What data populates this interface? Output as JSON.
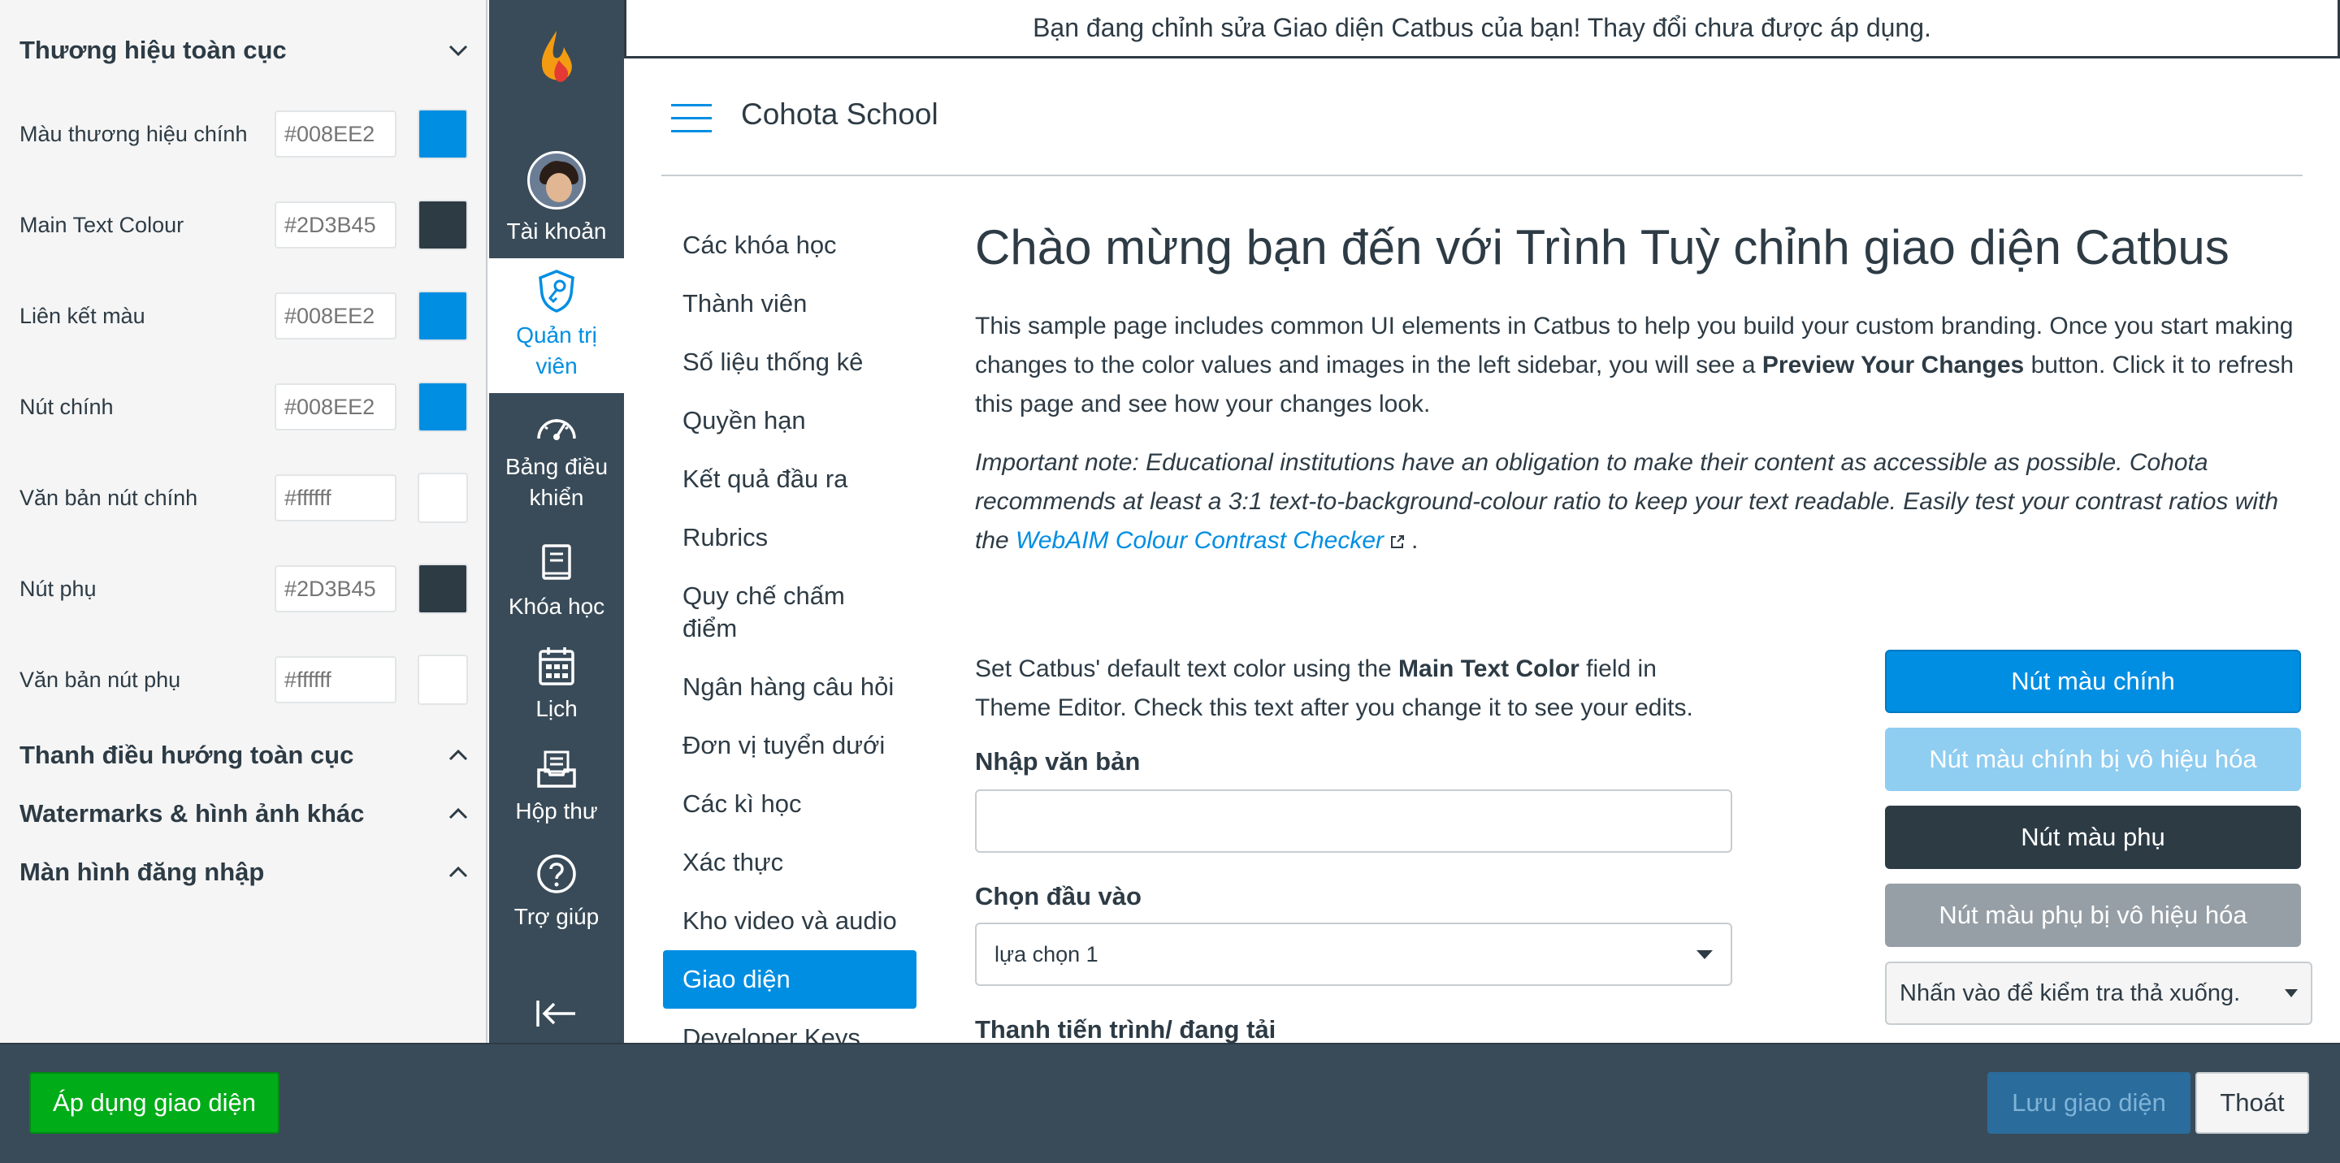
{
  "editor": {
    "sections": {
      "global_branding": "Thương hiệu toàn cục",
      "global_nav": "Thanh điều hướng toàn cục",
      "watermarks": "Watermarks & hình ảnh khác",
      "login_screen": "Màn hình đăng nhập"
    },
    "colors": [
      {
        "label": "Màu thương hiệu chính",
        "placeholder": "#008EE2",
        "swatch": "#008EE2"
      },
      {
        "label": "Main Text Colour",
        "placeholder": "#2D3B45",
        "swatch": "#2D3B45"
      },
      {
        "label": "Liên kết màu",
        "placeholder": "#008EE2",
        "swatch": "#008EE2"
      },
      {
        "label": "Nút chính",
        "placeholder": "#008EE2",
        "swatch": "#008EE2"
      },
      {
        "label": "Văn bản nút chính",
        "placeholder": "#ffffff",
        "swatch": "#ffffff"
      },
      {
        "label": "Nút phụ",
        "placeholder": "#2D3B45",
        "swatch": "#2D3B45"
      },
      {
        "label": "Văn bản nút phụ",
        "placeholder": "#ffffff",
        "swatch": "#ffffff"
      }
    ]
  },
  "global_nav": {
    "account": "Tài khoản",
    "admin": "Quản trị viên",
    "dashboard": "Bảng điều khiển",
    "courses": "Khóa học",
    "calendar": "Lịch",
    "inbox": "Hộp thư",
    "help": "Trợ giúp"
  },
  "banner": "Bạn đang chỉnh sửa Giao diện Catbus của bạn! Thay đổi chưa được áp dụng.",
  "header": {
    "account_name": "Cohota School"
  },
  "subnav": [
    "Các khóa học",
    "Thành viên",
    "Số liệu thống kê",
    "Quyền hạn",
    "Kết quả đầu ra",
    "Rubrics",
    "Quy chế chấm điểm",
    "Ngân hàng câu hỏi",
    "Đơn vị tuyển dưới",
    "Các kì học",
    "Xác thực",
    "Kho video và audio",
    "Giao diện",
    "Developer Keys"
  ],
  "content": {
    "title": "Chào mừng bạn đến với Trình Tuỳ chỉnh giao diện Catbus",
    "intro_1": "This sample page includes common UI elements in Catbus to help you build your custom branding. Once you start making changes to the color values and images in the left sidebar, you will see a ",
    "intro_bold": "Preview Your Changes",
    "intro_2": " button. Click it to refresh this page and see how your changes look.",
    "note": "Important note: Educational institutions have an obligation to make their content as accessible as possible. Cohota recommends at least a 3:1 text-to-background-colour ratio to keep your text readable. Easily test your contrast ratios with the ",
    "note_link": "WebAIM Colour Contrast Checker",
    "note_end": ".",
    "text_color_1": "Set Catbus' default text color using the ",
    "text_color_bold": "Main Text Color",
    "text_color_2": " field in Theme Editor. Check this text after you change it to see your edits.",
    "input_label": "Nhập văn bản",
    "select_label": "Chọn đầu vào",
    "select_value": "lựa chọn 1",
    "progress_label": "Thanh tiến trình/ đang tải"
  },
  "sample_buttons": {
    "primary": "Nút màu chính",
    "primary_disabled": "Nút màu chính bị vô hiệu hóa",
    "secondary": "Nút màu phụ",
    "secondary_disabled": "Nút màu phụ bị vô hiệu hóa",
    "dropdown": "Nhấn vào để kiểm tra thả xuống."
  },
  "footer": {
    "apply": "Áp dụng giao diện",
    "save": "Lưu giao diện",
    "exit": "Thoát"
  },
  "theme_colors": {
    "primary": "#008EE2",
    "text": "#2D3B45",
    "nav_bg": "#394B58",
    "apply_green": "#00AC18"
  }
}
